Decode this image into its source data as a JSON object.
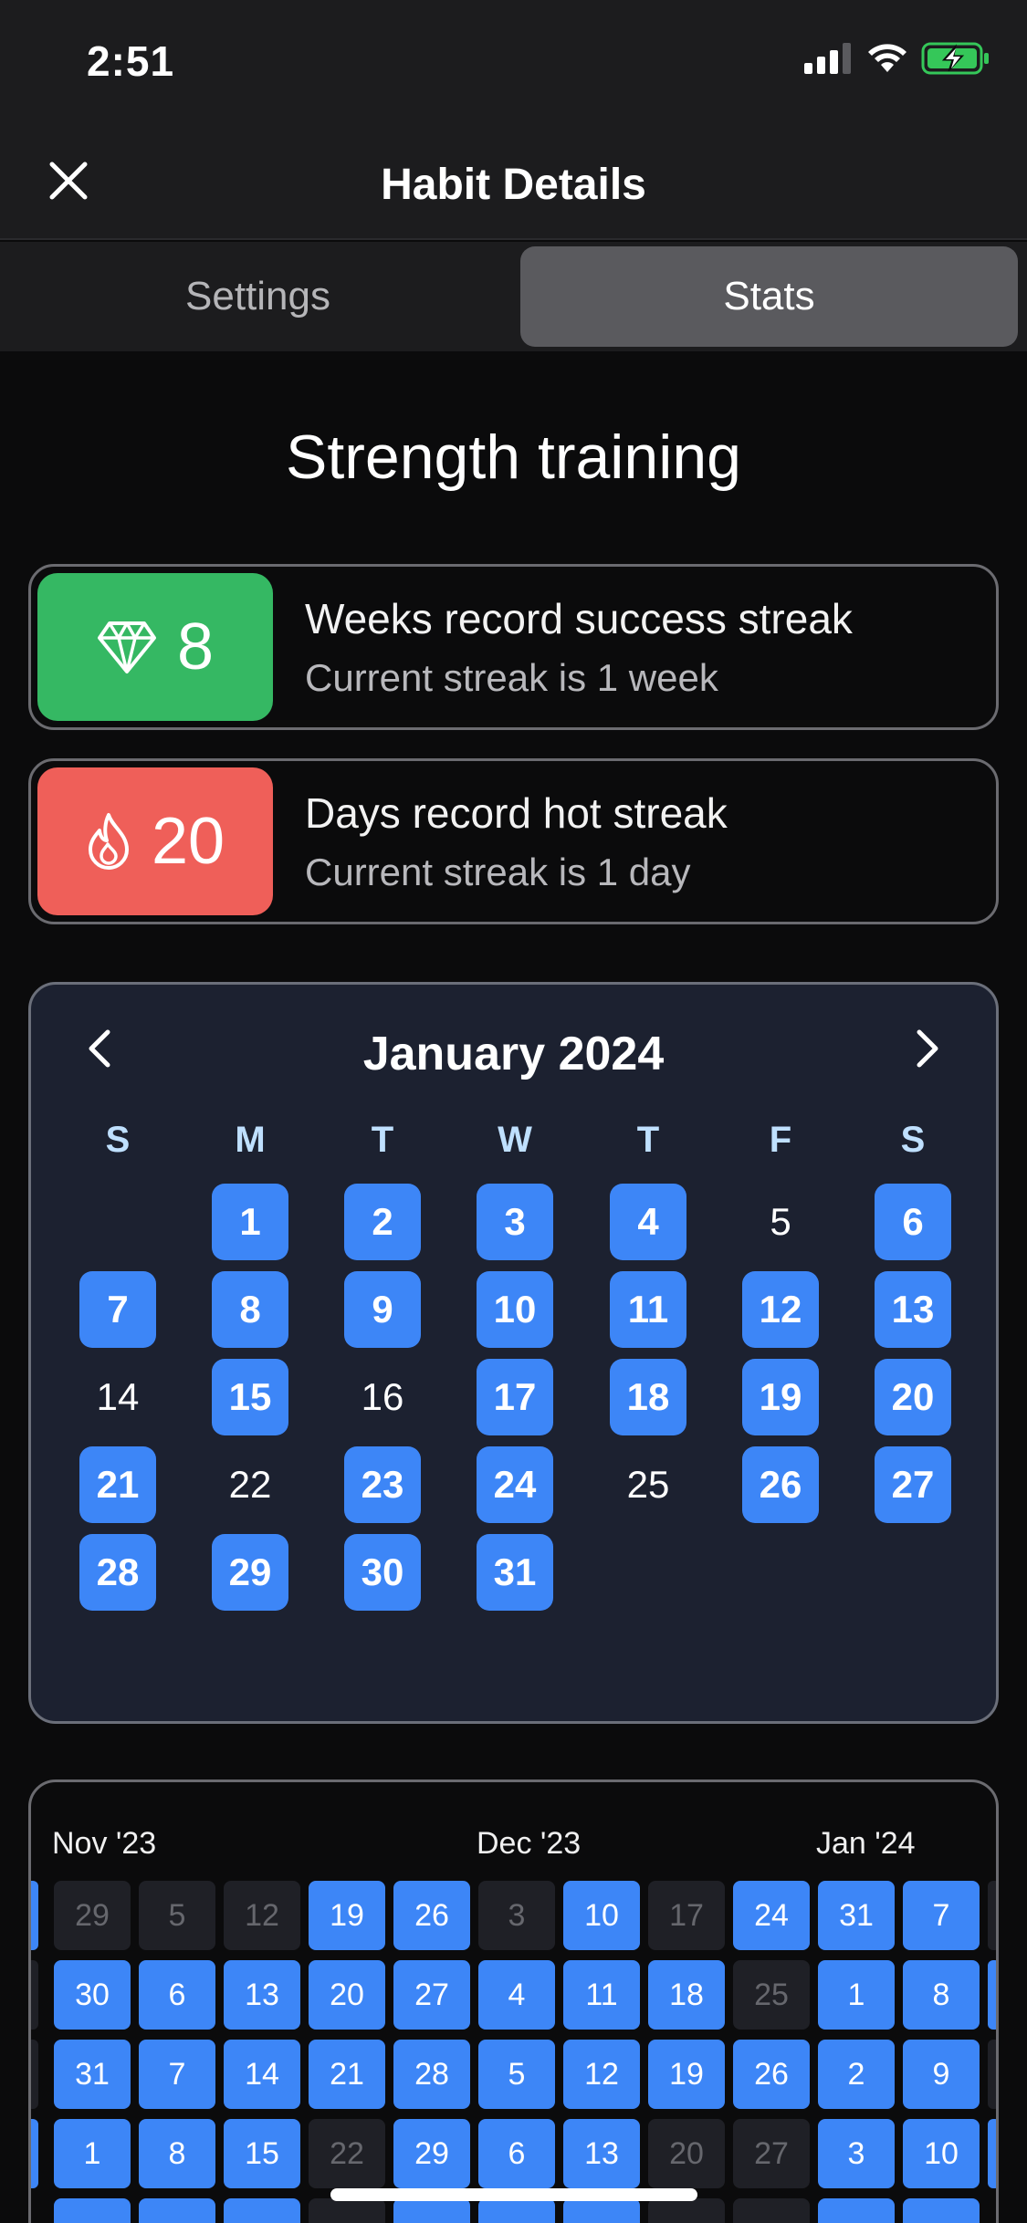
{
  "status_bar": {
    "time": "2:51"
  },
  "header": {
    "title": "Habit Details"
  },
  "tabs": [
    {
      "label": "Settings",
      "active": false
    },
    {
      "label": "Stats",
      "active": true
    }
  ],
  "habit": {
    "name": "Strength training"
  },
  "streaks": [
    {
      "value": "8",
      "icon": "diamond-icon",
      "color": "#35b863",
      "title": "Weeks record success streak",
      "subtitle": "Current streak is 1 week"
    },
    {
      "value": "20",
      "icon": "flame-icon",
      "color": "#ef5f59",
      "title": "Days record hot streak",
      "subtitle": "Current streak is 1 day"
    }
  ],
  "calendar": {
    "month_label": "January 2024",
    "weekdays": [
      "S",
      "M",
      "T",
      "W",
      "T",
      "F",
      "S"
    ],
    "first_weekday_index": 1,
    "days": [
      {
        "d": "1",
        "done": true
      },
      {
        "d": "2",
        "done": true
      },
      {
        "d": "3",
        "done": true
      },
      {
        "d": "4",
        "done": true
      },
      {
        "d": "5",
        "done": false
      },
      {
        "d": "6",
        "done": true
      },
      {
        "d": "7",
        "done": true
      },
      {
        "d": "8",
        "done": true
      },
      {
        "d": "9",
        "done": true
      },
      {
        "d": "10",
        "done": true
      },
      {
        "d": "11",
        "done": true
      },
      {
        "d": "12",
        "done": true
      },
      {
        "d": "13",
        "done": true
      },
      {
        "d": "14",
        "done": false
      },
      {
        "d": "15",
        "done": true
      },
      {
        "d": "16",
        "done": false
      },
      {
        "d": "17",
        "done": true
      },
      {
        "d": "18",
        "done": true
      },
      {
        "d": "19",
        "done": true
      },
      {
        "d": "20",
        "done": true
      },
      {
        "d": "21",
        "done": true
      },
      {
        "d": "22",
        "done": false
      },
      {
        "d": "23",
        "done": true
      },
      {
        "d": "24",
        "done": true
      },
      {
        "d": "25",
        "done": false
      },
      {
        "d": "26",
        "done": true
      },
      {
        "d": "27",
        "done": true
      },
      {
        "d": "28",
        "done": true
      },
      {
        "d": "29",
        "done": true
      },
      {
        "d": "30",
        "done": true
      },
      {
        "d": "31",
        "done": true
      }
    ]
  },
  "heatmap": {
    "month_labels": [
      "Nov '23",
      "Dec '23",
      "Jan '24"
    ],
    "month_label_columns": [
      0,
      5,
      9
    ],
    "rows": [
      [
        {
          "d": "29",
          "done": false
        },
        {
          "d": "5",
          "done": false
        },
        {
          "d": "12",
          "done": false
        },
        {
          "d": "19",
          "done": true
        },
        {
          "d": "26",
          "done": true
        },
        {
          "d": "3",
          "done": false
        },
        {
          "d": "10",
          "done": true
        },
        {
          "d": "17",
          "done": false
        },
        {
          "d": "24",
          "done": true
        },
        {
          "d": "31",
          "done": true
        },
        {
          "d": "7",
          "done": true
        }
      ],
      [
        {
          "d": "30",
          "done": true
        },
        {
          "d": "6",
          "done": true
        },
        {
          "d": "13",
          "done": true
        },
        {
          "d": "20",
          "done": true
        },
        {
          "d": "27",
          "done": true
        },
        {
          "d": "4",
          "done": true
        },
        {
          "d": "11",
          "done": true
        },
        {
          "d": "18",
          "done": true
        },
        {
          "d": "25",
          "done": false
        },
        {
          "d": "1",
          "done": true
        },
        {
          "d": "8",
          "done": true
        }
      ],
      [
        {
          "d": "31",
          "done": true
        },
        {
          "d": "7",
          "done": true
        },
        {
          "d": "14",
          "done": true
        },
        {
          "d": "21",
          "done": true
        },
        {
          "d": "28",
          "done": true
        },
        {
          "d": "5",
          "done": true
        },
        {
          "d": "12",
          "done": true
        },
        {
          "d": "19",
          "done": true
        },
        {
          "d": "26",
          "done": true
        },
        {
          "d": "2",
          "done": true
        },
        {
          "d": "9",
          "done": true
        }
      ],
      [
        {
          "d": "1",
          "done": true
        },
        {
          "d": "8",
          "done": true
        },
        {
          "d": "15",
          "done": true
        },
        {
          "d": "22",
          "done": false
        },
        {
          "d": "29",
          "done": true
        },
        {
          "d": "6",
          "done": true
        },
        {
          "d": "13",
          "done": true
        },
        {
          "d": "20",
          "done": false
        },
        {
          "d": "27",
          "done": false
        },
        {
          "d": "3",
          "done": true
        },
        {
          "d": "10",
          "done": true
        }
      ]
    ],
    "left_edge_done": [
      true,
      false,
      false,
      true
    ],
    "right_edge_done": [
      false,
      true,
      false,
      true
    ]
  }
}
